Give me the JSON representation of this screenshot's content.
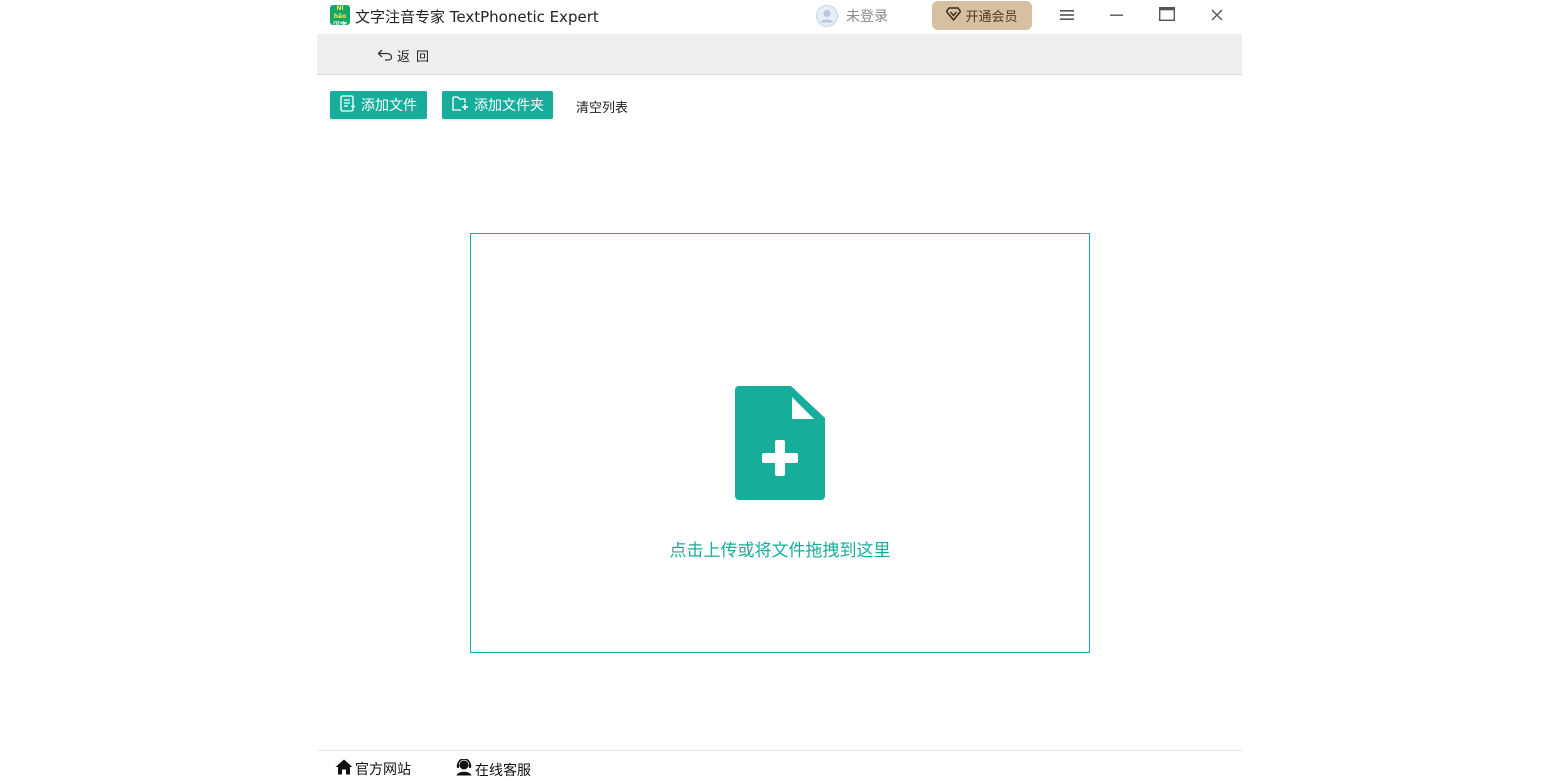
{
  "window": {
    "title": "文字注音专家 TextPhonetic Expert",
    "logo_top": "Nǐ hǎo",
    "logo_text": "汉字"
  },
  "header": {
    "login_text": "未登录",
    "vip_label": "开通会员"
  },
  "backbar": {
    "back_label": "返回"
  },
  "toolbar": {
    "add_file_label": "添加文件",
    "add_folder_label": "添加文件夹",
    "clear_list_label": "清空列表"
  },
  "dropzone": {
    "hint": "点击上传或将文件拖拽到这里"
  },
  "footer": {
    "website_label": "官方网站",
    "support_label": "在线客服"
  },
  "colors": {
    "accent": "#16ad9a",
    "vip_bg": "#d6bfa2",
    "backbar_bg": "#eeeeee"
  },
  "icons": [
    "app-logo",
    "avatar-icon",
    "diamond-icon",
    "menu-icon",
    "minimize-icon",
    "maximize-icon",
    "close-icon",
    "back-arrow-icon",
    "file-list-icon",
    "folder-add-icon",
    "file-add-icon",
    "home-icon",
    "support-agent-icon"
  ]
}
